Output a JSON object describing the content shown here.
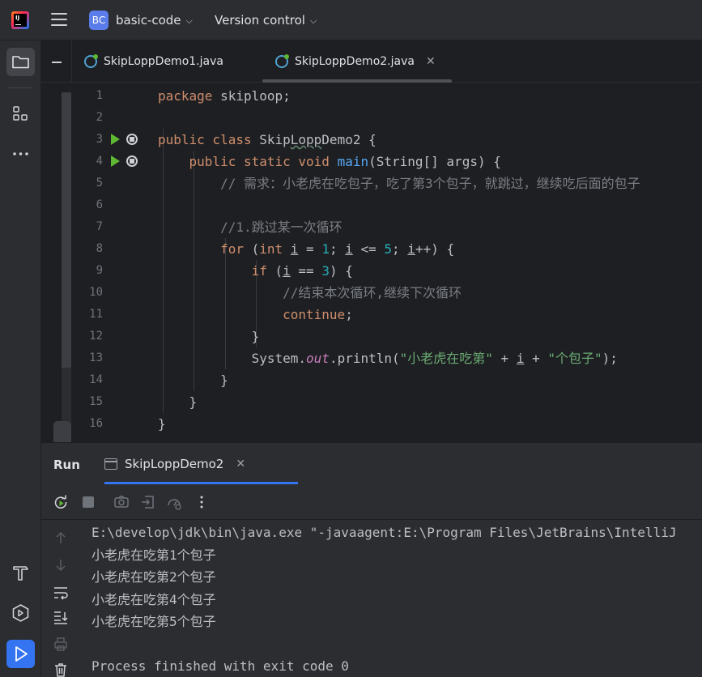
{
  "titlebar": {
    "logo_text": "IJ",
    "project_badge": "BC",
    "project_name": "basic-code",
    "vcs_label": "Version control"
  },
  "tabs": [
    {
      "label": "SkipLoppDemo1.java",
      "active": false
    },
    {
      "label": "SkipLoppDemo2.java",
      "active": true
    }
  ],
  "tab_close_glyph": "✕",
  "editor": {
    "line_numbers": [
      "1",
      "2",
      "3",
      "4",
      "5",
      "6",
      "7",
      "8",
      "9",
      "10",
      "11",
      "12",
      "13",
      "14",
      "15",
      "16"
    ],
    "code_lines": [
      [
        {
          "t": "package ",
          "c": "kw"
        },
        {
          "t": "skiploop;",
          "c": ""
        }
      ],
      [],
      [
        {
          "t": "public class ",
          "c": "kw"
        },
        {
          "t": "Skip",
          "c": ""
        },
        {
          "t": "Lopp",
          "c": "wavy"
        },
        {
          "t": "Demo2 {",
          "c": ""
        }
      ],
      [
        {
          "t": "    public static void ",
          "c": "kw"
        },
        {
          "t": "main",
          "c": "fn"
        },
        {
          "t": "(String[] args) {",
          "c": ""
        }
      ],
      [
        {
          "t": "        // 需求：小老虎在吃包子，吃了第3个包子，就跳过，继续吃后面的包子",
          "c": "cm"
        }
      ],
      [],
      [
        {
          "t": "        //1.跳过某一次循环",
          "c": "cm"
        }
      ],
      [
        {
          "t": "        for ",
          "c": "kw"
        },
        {
          "t": "(",
          "c": ""
        },
        {
          "t": "int ",
          "c": "kw"
        },
        {
          "t": "i",
          "c": "ul"
        },
        {
          "t": " = ",
          "c": ""
        },
        {
          "t": "1",
          "c": "num"
        },
        {
          "t": "; ",
          "c": ""
        },
        {
          "t": "i",
          "c": "ul"
        },
        {
          "t": " <= ",
          "c": ""
        },
        {
          "t": "5",
          "c": "num"
        },
        {
          "t": "; ",
          "c": ""
        },
        {
          "t": "i",
          "c": "ul"
        },
        {
          "t": "++) {",
          "c": ""
        }
      ],
      [
        {
          "t": "            if ",
          "c": "kw"
        },
        {
          "t": "(",
          "c": ""
        },
        {
          "t": "i",
          "c": "ul"
        },
        {
          "t": " == ",
          "c": ""
        },
        {
          "t": "3",
          "c": "num"
        },
        {
          "t": ") {",
          "c": ""
        }
      ],
      [
        {
          "t": "                //结束本次循环,继续下次循环",
          "c": "cm"
        }
      ],
      [
        {
          "t": "                continue",
          "c": "kw"
        },
        {
          "t": ";",
          "c": ""
        }
      ],
      [
        {
          "t": "            }",
          "c": ""
        }
      ],
      [
        {
          "t": "            System.",
          "c": ""
        },
        {
          "t": "out",
          "c": "st"
        },
        {
          "t": ".println(",
          "c": ""
        },
        {
          "t": "\"小老虎在吃第\"",
          "c": "str"
        },
        {
          "t": " + ",
          "c": ""
        },
        {
          "t": "i",
          "c": "ul"
        },
        {
          "t": " + ",
          "c": ""
        },
        {
          "t": "\"个包子\"",
          "c": "str"
        },
        {
          "t": ");",
          "c": ""
        }
      ],
      [
        {
          "t": "        }",
          "c": ""
        }
      ],
      [
        {
          "t": "    }",
          "c": ""
        }
      ],
      [
        {
          "t": "}",
          "c": ""
        }
      ]
    ]
  },
  "run_panel": {
    "title": "Run",
    "tab_label": "SkipLoppDemo2",
    "console_lines": [
      "E:\\develop\\jdk\\bin\\java.exe \"-javaagent:E:\\Program Files\\JetBrains\\IntelliJ",
      "小老虎在吃第1个包子",
      "小老虎在吃第2个包子",
      "小老虎在吃第4个包子",
      "小老虎在吃第5个包子",
      "",
      "Process finished with exit code 0"
    ]
  },
  "colors": {
    "accent": "#3574f0",
    "run_green": "#5fb832",
    "keyword": "#cf8e6d",
    "string": "#6aab73",
    "comment": "#7a7e85",
    "number": "#2aacb8",
    "function": "#56a8f5"
  },
  "icons": [
    "hamburger-icon",
    "chevron-down-icon",
    "folder-icon",
    "structure-icon",
    "more-icon",
    "build-icon",
    "services-icon",
    "run-icon",
    "rerun-icon",
    "stop-icon",
    "camera-icon",
    "exit-icon",
    "profiler-icon",
    "kebab-icon",
    "arrow-up-icon",
    "arrow-down-icon",
    "soft-wrap-icon",
    "scroll-to-end-icon",
    "print-icon",
    "trash-icon"
  ]
}
